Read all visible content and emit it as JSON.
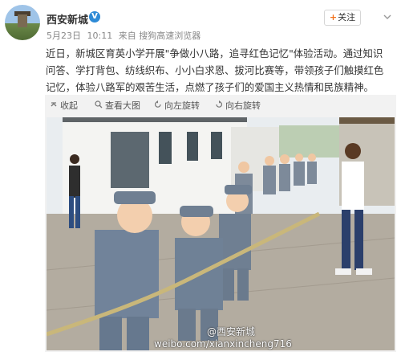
{
  "post": {
    "username": "西安新城",
    "verified_badge": "V",
    "date": "5月23日",
    "time": "10:11",
    "source": "来自 搜狗高速浏览器",
    "follow_label": "关注",
    "follow_plus": "+",
    "text": "近日，新城区育英小学开展\"争做小八路，追寻红色记忆\"体验活动。通过知识问答、学打背包、纺线织布、小小白求恩、拔河比赛等，带领孩子们触摸红色记忆，体验八路军的艰苦生活，点燃了孩子们的爱国主义热情和民族精神。"
  },
  "media_toolbar": {
    "collapse": "收起",
    "view_large": "查看大图",
    "rotate_left": "向左旋转",
    "rotate_right": "向右旋转"
  },
  "icons": {
    "collapse": "collapse-icon",
    "view_large": "magnifier-icon",
    "rotate_left": "rotate-left-icon",
    "rotate_right": "rotate-right-icon",
    "follow": "plus-icon",
    "more": "chevron-down-icon"
  },
  "watermark": {
    "handle": "@西安新城",
    "url": "weibo.com/xianxincheng716"
  },
  "colors": {
    "accent": "#f2711c",
    "verified": "#2d8ad6",
    "uniform": "#6f7f92"
  }
}
